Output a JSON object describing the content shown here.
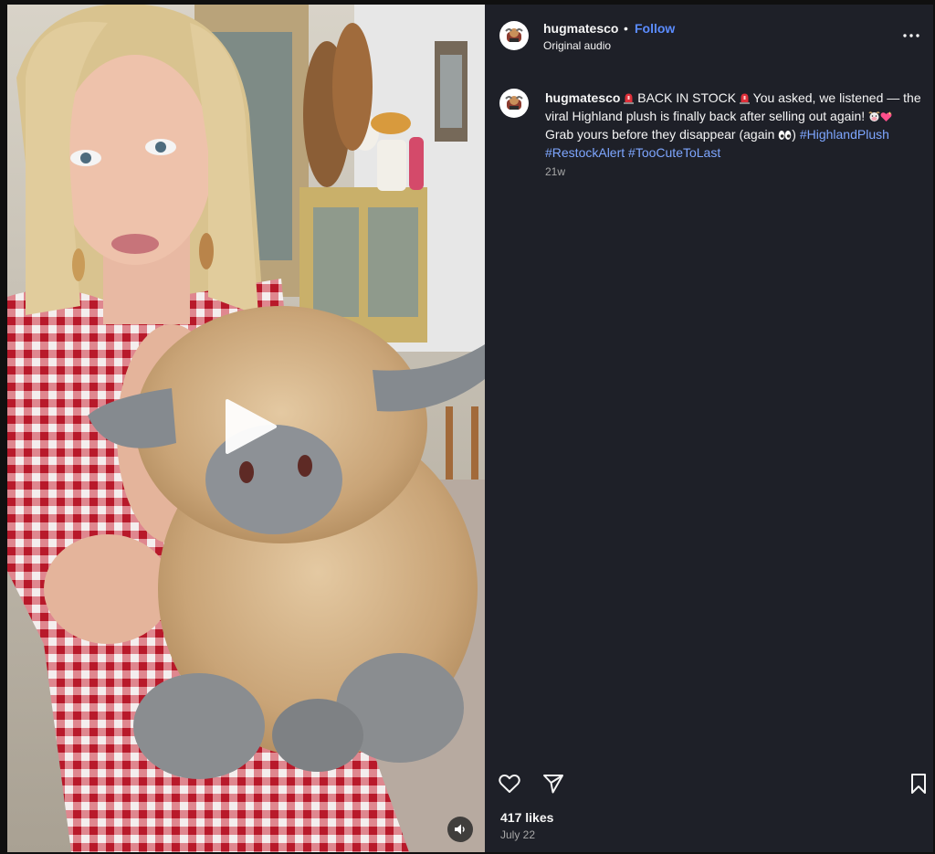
{
  "post": {
    "username": "hugmatesco",
    "separator": "•",
    "follow_label": "Follow",
    "audio_label": "Original audio",
    "caption": {
      "username": "hugmatesco",
      "part1": " BACK IN STOCK ",
      "part2": " You asked, we listened — the viral Highland plush is finally back after selling out again! ",
      "part3": " Grab yours before they disappear (again ",
      "part4": ") ",
      "hashtags": [
        "#HighlandPlush",
        "#RestockAlert",
        "#TooCuteToLast"
      ]
    },
    "time_ago": "21w",
    "likes": "417 likes",
    "date": "July 22"
  },
  "icons": {
    "header_more": "more-options-icon",
    "like": "heart-icon",
    "share": "share-icon",
    "save": "bookmark-icon",
    "play": "play-icon",
    "audio": "speaker-icon"
  },
  "colors": {
    "panel_bg": "#1e2028",
    "follow": "#5b8cff",
    "hashtag": "#7ea6ff",
    "muted_text": "#a8a8a8"
  }
}
